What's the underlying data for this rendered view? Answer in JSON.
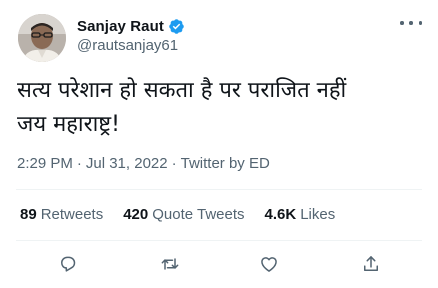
{
  "author": {
    "display_name": "Sanjay Raut",
    "handle": "@rautsanjay61",
    "verified": true
  },
  "tweet": {
    "text": "सत्य परेशान हो सकता है पर पराजित नहीं\nजय महाराष्ट्र!",
    "time": "2:29 PM",
    "separator": "·",
    "date": "Jul 31, 2022",
    "source": "Twitter by ED"
  },
  "stats": {
    "retweets_count": "89",
    "retweets_label": "Retweets",
    "quotes_count": "420",
    "quotes_label": "Quote Tweets",
    "likes_count": "4.6K",
    "likes_label": "Likes"
  },
  "icons": {
    "verified": "verified-badge-icon",
    "more": "more-dots-icon",
    "reply": "reply-icon",
    "retweet": "retweet-icon",
    "like": "like-icon",
    "share": "share-icon"
  },
  "colors": {
    "verified": "#1d9bf0",
    "secondary_text": "#536471",
    "primary_text": "#0f1419"
  }
}
